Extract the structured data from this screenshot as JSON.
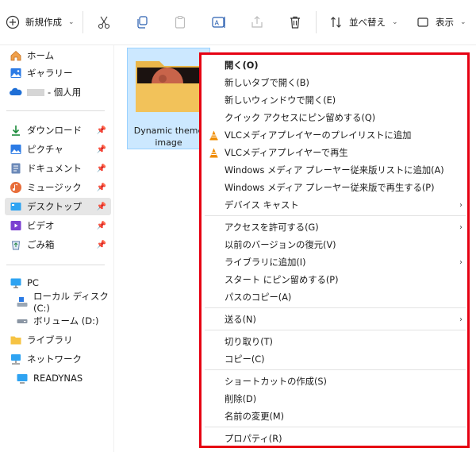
{
  "toolbar": {
    "new_label": "新規作成",
    "sort_label": "並べ替え",
    "view_label": "表示"
  },
  "sidebar": {
    "quick": [
      {
        "label": "ホーム",
        "icon": "home-icon"
      },
      {
        "label": "ギャラリー",
        "icon": "gallery-icon"
      },
      {
        "label": "- 個人用",
        "icon": "onedrive-cloud-icon"
      }
    ],
    "pinned": [
      {
        "label": "ダウンロード",
        "icon": "download-icon"
      },
      {
        "label": "ピクチャ",
        "icon": "pictures-icon"
      },
      {
        "label": "ドキュメント",
        "icon": "documents-icon"
      },
      {
        "label": "ミュージック",
        "icon": "music-icon"
      },
      {
        "label": "デスクトップ",
        "icon": "desktop-icon",
        "selected": true
      },
      {
        "label": "ビデオ",
        "icon": "videos-icon"
      },
      {
        "label": "ごみ箱",
        "icon": "recycle-bin-icon"
      }
    ],
    "tree": [
      {
        "label": "PC",
        "icon": "pc-icon"
      },
      {
        "label": "ローカル ディスク (C:)",
        "icon": "local-disk-icon"
      },
      {
        "label": "ボリューム (D:)",
        "icon": "volume-icon"
      },
      {
        "label": "ライブラリ",
        "icon": "library-folder-icon"
      },
      {
        "label": "ネットワーク",
        "icon": "network-icon"
      },
      {
        "label": "READYNAS",
        "icon": "nas-icon"
      }
    ]
  },
  "file": {
    "name_line1": "Dynamic theme",
    "name_line2": "image"
  },
  "context_menu": {
    "groups": [
      [
        {
          "label": "開く(O)",
          "bold": true
        },
        {
          "label": "新しいタブで開く(B)"
        },
        {
          "label": "新しいウィンドウで開く(E)"
        },
        {
          "label": "クイック アクセスにピン留めする(Q)"
        },
        {
          "label": "VLCメディアプレイヤーのプレイリストに追加",
          "icon": "vlc-icon"
        },
        {
          "label": "VLCメディアプレイヤーで再生",
          "icon": "vlc-icon"
        },
        {
          "label": "Windows メディア プレーヤー従来版リストに追加(A)"
        },
        {
          "label": "Windows メディア プレーヤー従来版で再生する(P)"
        },
        {
          "label": "デバイス キャスト",
          "submenu": true
        }
      ],
      [
        {
          "label": "アクセスを許可する(G)",
          "submenu": true
        },
        {
          "label": "以前のバージョンの復元(V)"
        },
        {
          "label": "ライブラリに追加(I)",
          "submenu": true
        },
        {
          "label": "スタート にピン留めする(P)"
        },
        {
          "label": "パスのコピー(A)"
        }
      ],
      [
        {
          "label": "送る(N)",
          "submenu": true
        }
      ],
      [
        {
          "label": "切り取り(T)"
        },
        {
          "label": "コピー(C)"
        }
      ],
      [
        {
          "label": "ショートカットの作成(S)"
        },
        {
          "label": "削除(D)"
        },
        {
          "label": "名前の変更(M)"
        }
      ],
      [
        {
          "label": "プロパティ(R)"
        }
      ]
    ]
  },
  "colors": {
    "highlight_border": "#e60012",
    "selection": "#cce8ff",
    "sidebar_selected": "#e6e6e6"
  }
}
